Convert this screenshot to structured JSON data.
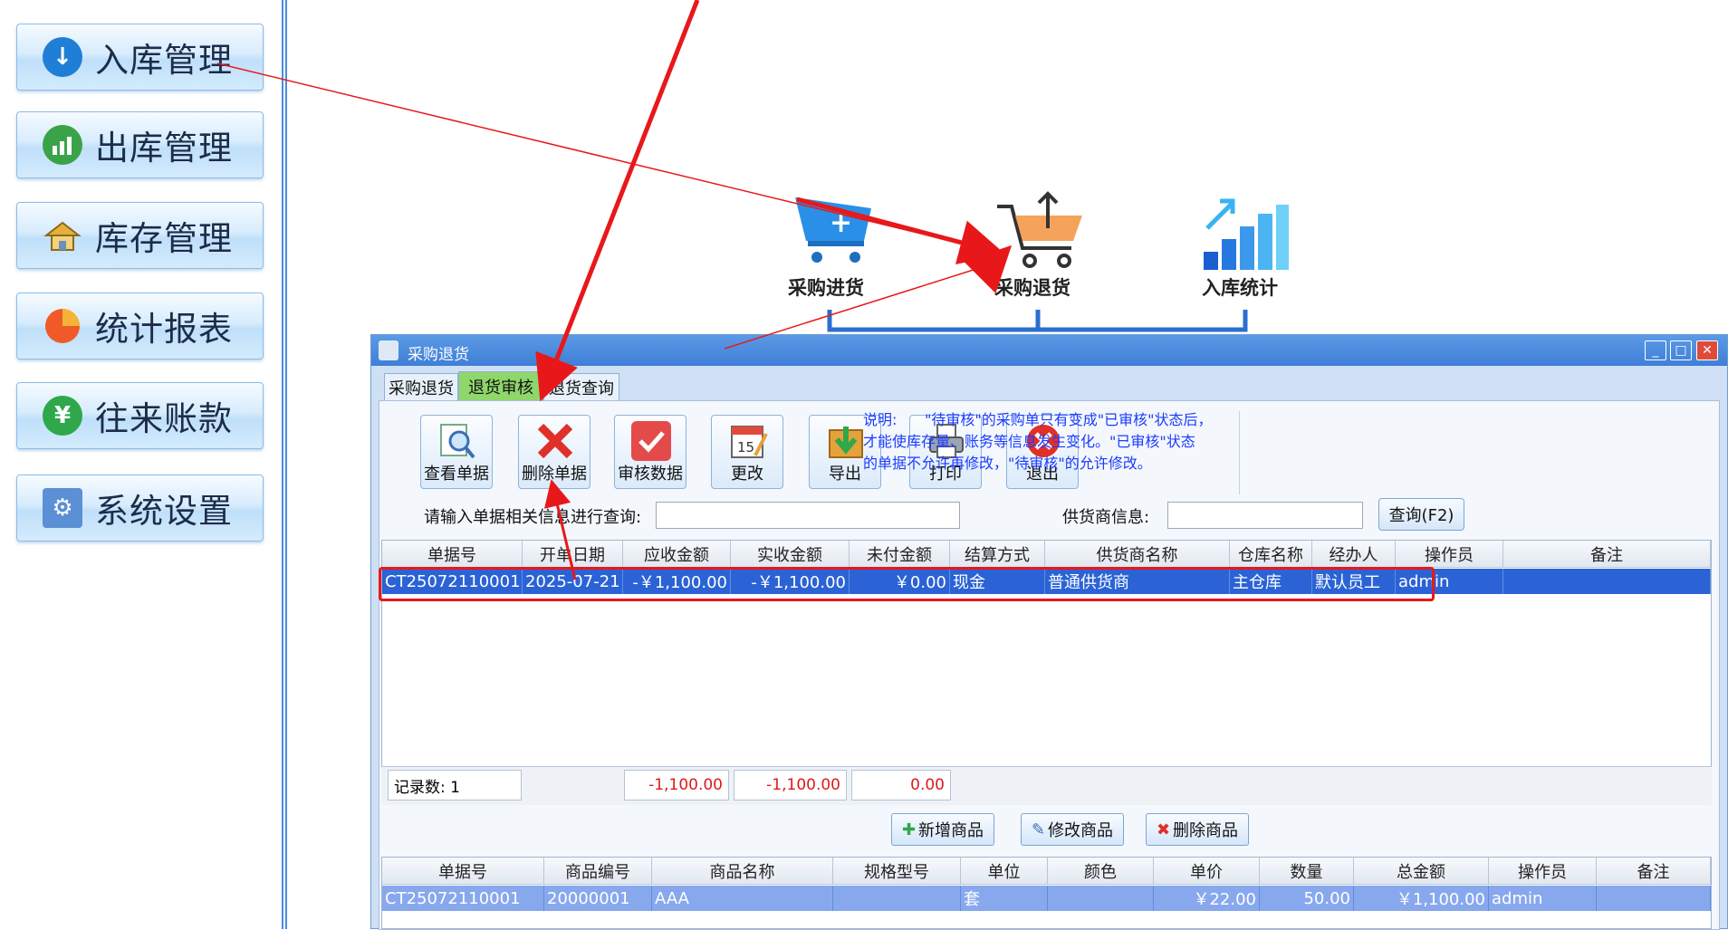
{
  "nav": [
    {
      "label": "入库管理",
      "icon": "arrow-down-icon",
      "color": "#1f7fd6"
    },
    {
      "label": "出库管理",
      "icon": "chart-up-icon",
      "color": "#3aa34a"
    },
    {
      "label": "库存管理",
      "icon": "warehouse-icon",
      "color": "#e6a23a"
    },
    {
      "label": "统计报表",
      "icon": "pie-chart-icon",
      "color": "#f05a28"
    },
    {
      "label": "往来账款",
      "icon": "yen-icon",
      "color": "#2ea84a"
    },
    {
      "label": "系统设置",
      "icon": "gear-icon",
      "color": "#5b8fd6"
    }
  ],
  "flow": {
    "purchase_in": "采购进货",
    "purchase_return": "采购退货",
    "in_stats": "入库统计"
  },
  "window": {
    "title": "采购退货",
    "tabs": [
      "采购退货",
      "退货审核",
      "退货查询"
    ],
    "active_tab": "退货审核"
  },
  "toolbar": [
    "查看单据",
    "删除单据",
    "审核数据",
    "更改",
    "导出",
    "打印",
    "退出"
  ],
  "note": {
    "heading": "说明:",
    "line1": "\"待审核\"的采购单只有变成\"已审核\"状态后，",
    "line2": "才能使库存量、账务等信息发生变化。\"已审核\"状态",
    "line3": "的单据不允许再修改，\"待审核\"的允许修改。"
  },
  "query": {
    "label": "请输入单据相关信息进行查询:",
    "value": "",
    "supplier_label": "供货商信息:",
    "supplier_value": "",
    "button": "查询(F2)"
  },
  "main_grid": {
    "headers": [
      "单据号",
      "开单日期",
      "应收金额",
      "实收金额",
      "未付金额",
      "结算方式",
      "供货商名称",
      "仓库名称",
      "经办人",
      "操作员",
      "备注"
    ],
    "rows": [
      [
        "CT25072110001",
        "2025-07-21",
        "-￥1,100.00",
        "-￥1,100.00",
        "￥0.00",
        "现金",
        "普通供货商",
        "主仓库",
        "默认员工",
        "admin",
        ""
      ]
    ]
  },
  "summary": {
    "count_label": "记录数: 1",
    "receivable": "-1,100.00",
    "received": "-1,100.00",
    "unpaid": "0.00"
  },
  "detail_buttons": [
    "新增商品",
    "修改商品",
    "删除商品"
  ],
  "detail_grid": {
    "headers": [
      "单据号",
      "商品编号",
      "商品名称",
      "规格型号",
      "单位",
      "颜色",
      "单价",
      "数量",
      "总金额",
      "操作员",
      "备注"
    ],
    "rows": [
      [
        "CT25072110001",
        "20000001",
        "AAA",
        "",
        "套",
        "",
        "￥22.00",
        "50.00",
        "￥1,100.00",
        "admin",
        ""
      ]
    ]
  }
}
